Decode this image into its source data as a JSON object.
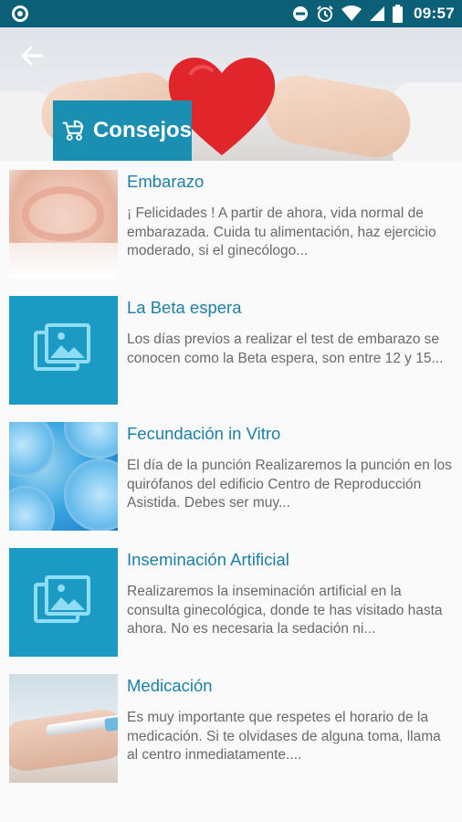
{
  "statusbar": {
    "time": "09:57",
    "icons": [
      "app-indicator-icon",
      "dnd-icon",
      "alarm-icon",
      "wifi-icon",
      "signal-icon",
      "battery-icon"
    ]
  },
  "header": {
    "title": "Consejos",
    "back_icon": "back-arrow-icon",
    "title_icon": "stroller-icon"
  },
  "items": [
    {
      "title": "Embarazo",
      "description": "¡ Felicidades ! A partir de ahora, vida normal de embarazada. Cuida tu alimentación, haz ejercicio moderado, si el ginecólogo...",
      "thumbnail": "hands-heart-photo"
    },
    {
      "title": "La Beta espera",
      "description": "Los días previos a realizar el test de embarazo se conocen como la Beta espera, son entre 12 y 15...",
      "thumbnail": "image-placeholder-icon"
    },
    {
      "title": "Fecundación in Vitro",
      "description": "El día de la punción Realizaremos la punción en los quirófanos del edificio Centro de Reproducción Asistida. Debes ser muy...",
      "thumbnail": "cells-photo"
    },
    {
      "title": "Inseminación Artificial",
      "description": "Realizaremos la inseminación artificial en la consulta ginecológica, donde te has visitado hasta ahora. No es necesaria la sedación ni...",
      "thumbnail": "image-placeholder-icon"
    },
    {
      "title": "Medicación",
      "description": "Es muy importante que respetes el horario de la medicación. Si te olvidases de alguna toma, llama al centro inmediatamente....",
      "thumbnail": "injection-photo"
    }
  ],
  "colors": {
    "statusbar": "#0b5f76",
    "accent": "#1b8fb1",
    "placeholder": "#1b9ac4",
    "title_text": "#1d7fa6",
    "body_text": "#6a6a6a",
    "heart": "#e0262b"
  }
}
